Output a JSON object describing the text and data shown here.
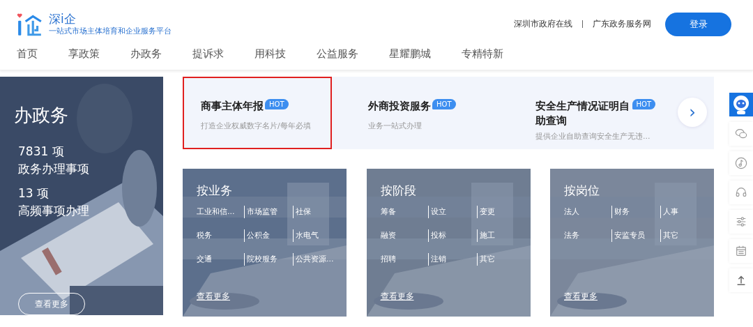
{
  "logo": {
    "name": "深i企",
    "slogan": "一站式市场主体培育和企业服务平台"
  },
  "top_links": [
    "深圳市政府在线",
    "广东政务服务网"
  ],
  "login_button": "登录",
  "nav": [
    {
      "label": "首页"
    },
    {
      "label": "享政策"
    },
    {
      "label": "办政务"
    },
    {
      "label": "提诉求"
    },
    {
      "label": "用科技"
    },
    {
      "label": "公益服务"
    },
    {
      "label": "星耀鹏城"
    },
    {
      "label": "专精特新"
    }
  ],
  "hero": {
    "title": "办政务",
    "stats": [
      {
        "count": "7831 项",
        "label": "政务办理事项"
      },
      {
        "count": "13 项",
        "label": "高频事项办理"
      }
    ],
    "more_button": "查看更多"
  },
  "services": [
    {
      "title": "商事主体年报",
      "badge": "HOT",
      "desc": "打造企业权威数字名片/每年必填",
      "selected": true
    },
    {
      "title": "外商投资服务",
      "badge": "HOT",
      "desc": "业务一站式办理",
      "selected": false
    },
    {
      "title": "安全生产情况证明自助查询",
      "badge": "HOT",
      "desc": "提供企业自助查询安全生产无违...",
      "selected": false
    }
  ],
  "next_button": "›",
  "cards": [
    {
      "title": "按业务",
      "links": [
        "工业和信...",
        "市场监管",
        "社保",
        "税务",
        "公积金",
        "水电气",
        "交通",
        "院校服务",
        "公共资源..."
      ],
      "more": "查看更多"
    },
    {
      "title": "按阶段",
      "links": [
        "筹备",
        "设立",
        "变更",
        "融资",
        "投标",
        "施工",
        "招聘",
        "注销",
        "其它"
      ],
      "more": "查看更多"
    },
    {
      "title": "按岗位",
      "links": [
        "法人",
        "财务",
        "人事",
        "法务",
        "安监专员",
        "其它"
      ],
      "more": "查看更多"
    }
  ]
}
